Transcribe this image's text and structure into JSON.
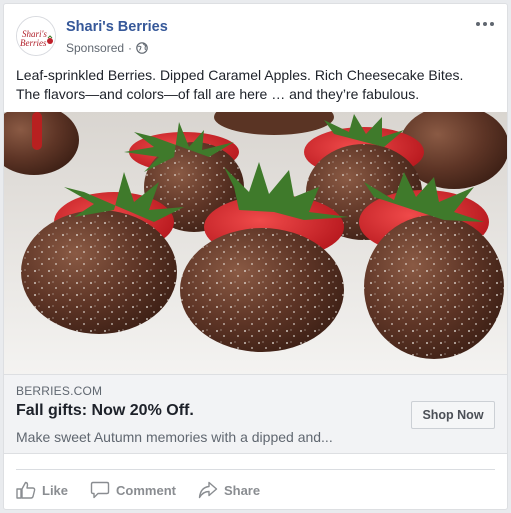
{
  "post": {
    "page_name": "Shari's Berries",
    "sponsored": "Sponsored",
    "separator": "·",
    "text_line1": "Leaf-sprinkled Berries. Dipped Caramel Apples. Rich Cheesecake Bites.",
    "text_line2": "The flavors—and colors—of fall are here … and they’re fabulous."
  },
  "link": {
    "domain": "BERRIES.COM",
    "headline": "Fall gifts: Now 20% Off.",
    "description": "Make sweet Autumn memories with a dipped and...",
    "cta_label": "Shop Now"
  },
  "actions": {
    "like": "Like",
    "comment": "Comment",
    "share": "Share"
  },
  "logo_text": "Shari's Berries",
  "icons": [
    "globe-icon",
    "more-options-icon",
    "like-icon",
    "comment-icon",
    "share-icon"
  ],
  "colors": {
    "page_name": "#365899",
    "action_text": "#8a8d91",
    "link_bg": "#f2f3f5"
  }
}
